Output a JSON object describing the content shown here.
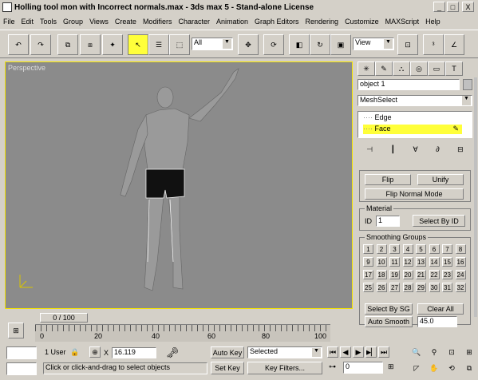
{
  "window": {
    "title": "Holling tool mon with Incorrect normals.max - 3ds max 5 - Stand-alone License",
    "controls": [
      "_",
      "□",
      "X"
    ]
  },
  "menu": [
    "File",
    "Edit",
    "Tools",
    "Group",
    "Views",
    "Create",
    "Modifiers",
    "Character",
    "Animation",
    "Graph Editors",
    "Rendering",
    "Customize",
    "MAXScript",
    "Help"
  ],
  "toolbar": {
    "selection_filter": "All",
    "ref_coord": "View"
  },
  "viewport": {
    "label": "Perspective"
  },
  "command_panel": {
    "object_name": "object 1",
    "modifier_stack": "MeshSelect",
    "stack_items": [
      "Edge",
      "Face"
    ],
    "flip_button": "Flip",
    "unify_button": "Unify",
    "flip_normal_mode": "Flip Normal Mode",
    "material_group": "Material",
    "material_id": "1",
    "select_by_id": "Select By ID",
    "smoothing_group": "Smoothing Groups",
    "sg_numbers": [
      "1",
      "2",
      "3",
      "4",
      "5",
      "6",
      "7",
      "8",
      "9",
      "10",
      "11",
      "12",
      "13",
      "14",
      "15",
      "16",
      "17",
      "18",
      "19",
      "20",
      "21",
      "22",
      "23",
      "24",
      "25",
      "26",
      "27",
      "28",
      "29",
      "30",
      "31",
      "32"
    ],
    "select_by_sg": "Select By SG",
    "clear_all": "Clear All",
    "auto_smooth": "Auto Smooth",
    "auto_smooth_value": "45.0"
  },
  "timeline": {
    "frame_label": "0 / 100",
    "ticks": [
      "0",
      "20",
      "40",
      "60",
      "80",
      "100"
    ]
  },
  "status": {
    "lock_label": "1 User",
    "x_label": "X",
    "x_value": "16.119",
    "key_icon": "key-icon",
    "auto_key": "Auto Key",
    "selected": "Selected",
    "set_key": "Set Key",
    "key_filters": "Key Filters...",
    "prompt": "Click or click-and-drag to select objects",
    "frame_value": "0"
  }
}
